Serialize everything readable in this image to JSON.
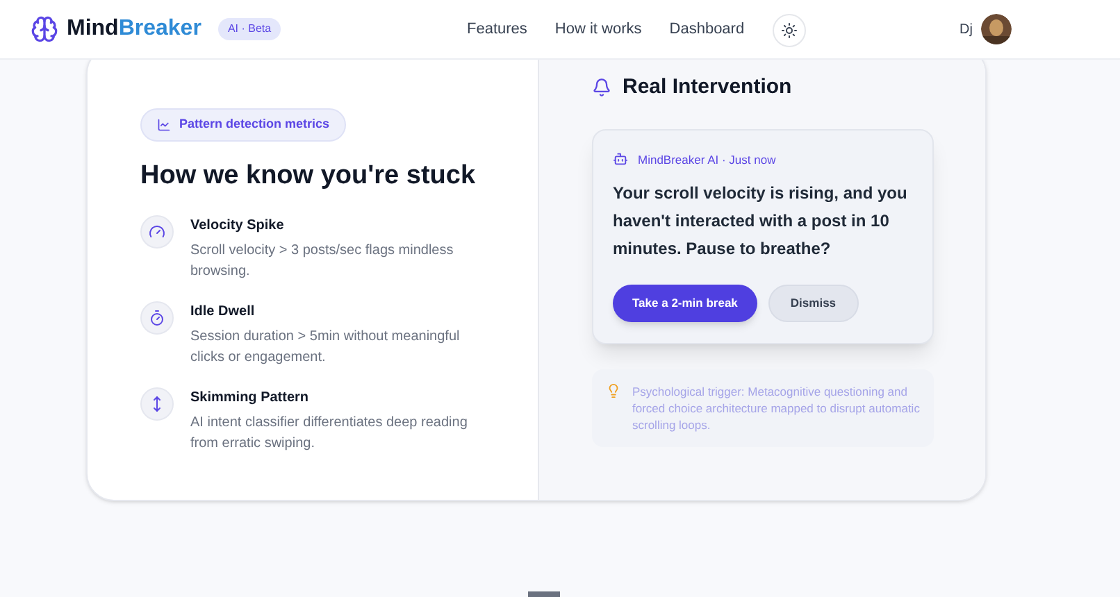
{
  "header": {
    "brand_first": "Mind",
    "brand_second": "Breaker",
    "badge": "AI · Beta",
    "nav": [
      {
        "label": "Features"
      },
      {
        "label": "How it works"
      },
      {
        "label": "Dashboard"
      }
    ],
    "user": "Dj"
  },
  "metrics": {
    "badge": "Pattern detection metrics",
    "title": "How we know you're stuck",
    "items": [
      {
        "kind": "gauge",
        "title": "Velocity Spike",
        "text": "Scroll velocity > 3 posts/sec flags mindless browsing."
      },
      {
        "kind": "timer",
        "title": "Idle Dwell",
        "text": "Session duration > 5min without meaningful clicks or engagement."
      },
      {
        "kind": "vertical",
        "title": "Skimming Pattern",
        "text": "AI intent classifier differentiates deep reading from erratic swiping."
      }
    ]
  },
  "intervention": {
    "title": "Real Intervention",
    "sender": "MindBreaker AI · Just now",
    "message": "Your scroll velocity is rising, and you haven't interacted with a post in 10 minutes. Pause to breathe?",
    "buttons": [
      {
        "kind": "primary",
        "label": "Take a 2-min break"
      },
      {
        "kind": "secondary",
        "label": "Dismiss"
      }
    ],
    "note": "Psychological trigger: Metacognitive questioning and forced choice architecture mapped to disrupt automatic scrolling loops."
  }
}
